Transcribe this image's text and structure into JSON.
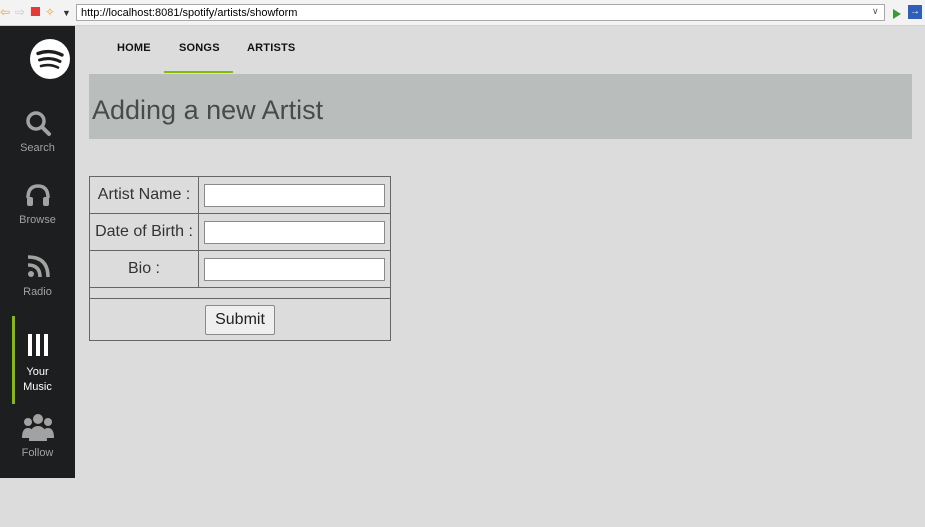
{
  "browser": {
    "url": "http://localhost:8081/spotify/artists/showform"
  },
  "sidebar": {
    "items": [
      {
        "label": "Search",
        "icon": "search-icon"
      },
      {
        "label": "Browse",
        "icon": "headphones-icon"
      },
      {
        "label": "Radio",
        "icon": "radio-icon"
      },
      {
        "label_line1": "Your",
        "label_line2": "Music",
        "icon": "library-icon",
        "active": true
      },
      {
        "label": "Follow",
        "icon": "people-icon"
      }
    ]
  },
  "topnav": {
    "tabs": [
      {
        "label": "HOME"
      },
      {
        "label": "SONGS",
        "active": true
      },
      {
        "label": "ARTISTS"
      }
    ]
  },
  "page": {
    "heading": "Adding a new Artist"
  },
  "form": {
    "artist_name_label": "Artist Name :",
    "artist_name_value": "",
    "dob_label": "Date of Birth :",
    "dob_value": "",
    "bio_label": "Bio :",
    "bio_value": "",
    "submit_label": "Submit"
  },
  "colors": {
    "accent": "#84bd00",
    "sidebar_bg": "#1d1e1f",
    "page_bg": "#dcdcdc",
    "banner_bg": "#b9bebd"
  }
}
